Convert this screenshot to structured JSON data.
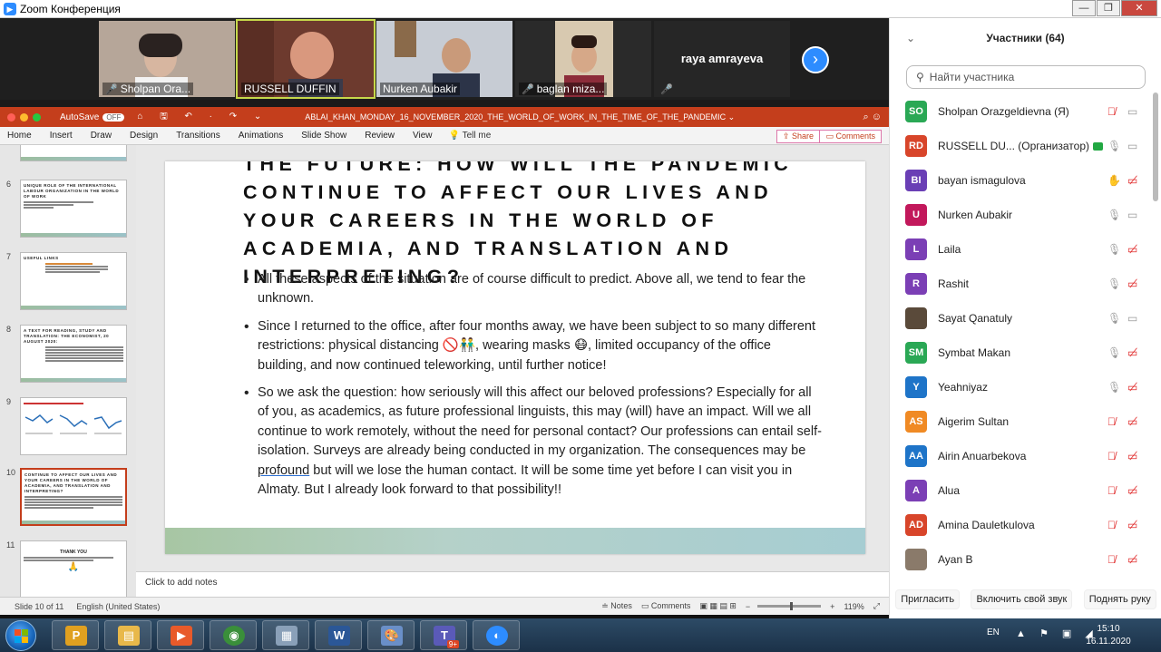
{
  "zoom_window": {
    "title": "Zoom Конференция",
    "controls": {
      "minimize": "—",
      "maximize": "❐",
      "close": "✕"
    }
  },
  "video_strip": {
    "tiles": [
      {
        "name": "Sholpan Ora...",
        "muted": true,
        "active": false,
        "bg": "#8f7a6c"
      },
      {
        "name": "RUSSELL DUFFIN",
        "muted": false,
        "active": true,
        "bg": "#7a4a3c"
      },
      {
        "name": "Nurken Aubakir",
        "muted": false,
        "active": false,
        "bg": "#7d8aa0"
      },
      {
        "name": "baglan miza...",
        "muted": true,
        "active": false,
        "bg": "#9a8b7a"
      }
    ],
    "name_only_tile": {
      "name": "raya amrayeva",
      "muted": true
    },
    "next_icon": "›"
  },
  "ppt": {
    "autosave_label": "AutoSave",
    "autosave_state": "OFF",
    "title_icons": "⌂ 🖫 ↶ · ↷ ⌄",
    "doc_title": "ABLAI_KHAN_MONDAY_16_NOVEMBER_2020_THE_WORLD_OF_WORK_IN_THE_TIME_OF_THE_PANDEMIC ⌄",
    "ribbon_tabs": [
      "Home",
      "Insert",
      "Draw",
      "Design",
      "Transitions",
      "Animations",
      "Slide Show",
      "Review",
      "View"
    ],
    "tell_me": "💡 Tell me",
    "share_label": "⇪ Share",
    "comments_label": "▭ Comments",
    "thumbnails": [
      {
        "num": "6",
        "title": "UNIQUE ROLE OF THE INTERNATIONAL LABOUR ORGANIZATION IN THE WORLD OF WORK",
        "kind": "text"
      },
      {
        "num": "7",
        "title": "USEFUL LINKS",
        "kind": "text"
      },
      {
        "num": "8",
        "title": "A TEXT FOR READING, STUDY AND TRANSLATION: THE ECONOMIST, 20 AUGUST 2020:",
        "kind": "text"
      },
      {
        "num": "9",
        "title": "",
        "kind": "chart"
      },
      {
        "num": "10",
        "title": "CONTINUE TO AFFECT OUR LIVES AND YOUR CAREERS IN THE WORLD OF ACADEMIA, AND TRANSLATION AND INTERPRETING?",
        "kind": "text"
      },
      {
        "num": "11",
        "title": "THANK YOU",
        "kind": "thanks"
      }
    ],
    "slide": {
      "title": "THE FUTURE: HOW WILL THE PANDEMIC CONTINUE TO AFFECT OUR LIVES AND YOUR CAREERS IN THE WORLD OF ACADEMIA, AND TRANSLATION AND INTERPRETING?",
      "bullet1": "All these aspects of the situation are of course difficult to predict. Above all, we tend to fear the unknown.",
      "bullet2_a": "Since I returned to the office, after four months away, we have been subject to so many different restrictions: physical distancing ",
      "bullet2_emoji1": "🚫👬",
      "bullet2_b": ", wearing masks ",
      "bullet2_emoji2": "😷",
      "bullet2_c": ", limited occupancy of the office building, and now continued teleworking, until further notice!",
      "bullet3_a": "So we ask the question: how seriously will this affect our beloved professions? Especially for all of you, as academics, as future professional linguists, this may (will) have an impact. Will we all continue to work remotely, without the need for personal contact? Our professions can entail self-isolation. Surveys are already being conducted in my organization. The consequences may be ",
      "bullet3_underlined": "profound",
      "bullet3_b": " but will we lose the human contact. It will be some time yet before I can visit you in Almaty. But I already look forward to that possibility!!"
    },
    "notes_placeholder": "Click to add notes",
    "status": {
      "slide_of": "Slide 10 of 11",
      "language": "English (United States)",
      "notes": "≐ Notes",
      "comments": "▭ Comments",
      "zoom_minus": "−",
      "zoom_plus": "+",
      "zoom_level": "119%"
    }
  },
  "participants_panel": {
    "title": "Участники (64)",
    "collapse_icon": "⌄",
    "search_placeholder": "Найти участника",
    "participants": [
      {
        "initials": "SO",
        "name": "Sholpan Orazgeldievna (Я)",
        "color": "#2aa855",
        "mic": "muted",
        "cam": "on"
      },
      {
        "initials": "RD",
        "name": "RUSSELL DU... (Организатор)",
        "color": "#d8452a",
        "mic": "on",
        "cam": "on",
        "sharing": true
      },
      {
        "initials": "BI",
        "name": "bayan ismagulova",
        "color": "#6a3fb5",
        "mic": "hand",
        "cam": "off"
      },
      {
        "initials": "U",
        "name": "Nurken Aubakir",
        "color": "#c2185b",
        "mic": "on",
        "cam": "on"
      },
      {
        "initials": "L",
        "name": "Laila",
        "color": "#7b3fb5",
        "mic": "on",
        "cam": "off"
      },
      {
        "initials": "R",
        "name": "Rashit",
        "color": "#7b3fb5",
        "mic": "on",
        "cam": "off"
      },
      {
        "initials": "",
        "name": "Sayat Qanatuly",
        "color": "#5a4a3a",
        "mic": "on",
        "cam": "on",
        "photo": true
      },
      {
        "initials": "SM",
        "name": "Symbat Makan",
        "color": "#2aa855",
        "mic": "on",
        "cam": "off"
      },
      {
        "initials": "Y",
        "name": "Yeahniyaz",
        "color": "#1e74c8",
        "mic": "on",
        "cam": "off"
      },
      {
        "initials": "AS",
        "name": "Aigerim Sultan",
        "color": "#f08a24",
        "mic": "muted",
        "cam": "off"
      },
      {
        "initials": "AA",
        "name": "Airin Anuarbekova",
        "color": "#1e74c8",
        "mic": "muted",
        "cam": "off"
      },
      {
        "initials": "A",
        "name": "Alua",
        "color": "#7b3fb5",
        "mic": "muted",
        "cam": "off"
      },
      {
        "initials": "AD",
        "name": "Amina Dauletkulova",
        "color": "#d8452a",
        "mic": "muted",
        "cam": "off"
      },
      {
        "initials": "",
        "name": "Ayan B",
        "color": "#8a7a6a",
        "mic": "muted",
        "cam": "off",
        "photo": true
      }
    ],
    "footer": {
      "invite": "Пригласить",
      "unmute": "Включить свой звук",
      "raise_hand": "Поднять руку"
    }
  },
  "taskbar": {
    "apps": [
      {
        "name": "ppt",
        "label": "P",
        "color": "#e0a020"
      },
      {
        "name": "explorer",
        "label": "▤",
        "color": "#e8b84a"
      },
      {
        "name": "media",
        "label": "▶",
        "color": "#e85a2a"
      },
      {
        "name": "chrome",
        "label": "◉",
        "color": "#3a8f3a"
      },
      {
        "name": "calc",
        "label": "▦",
        "color": "#8aa0b8"
      },
      {
        "name": "word",
        "label": "W",
        "color": "#2b5797"
      },
      {
        "name": "paint",
        "label": "🎨",
        "color": "#6a8fc8"
      },
      {
        "name": "teams",
        "label": "T",
        "color": "#5a5ab8",
        "badge": "9+"
      },
      {
        "name": "zoom",
        "label": "◐",
        "color": "#2d8cff"
      }
    ],
    "lang": "EN",
    "tray_icons": "▲ ⚑ ▣ ◢",
    "time": "15:10",
    "date": "16.11.2020"
  }
}
